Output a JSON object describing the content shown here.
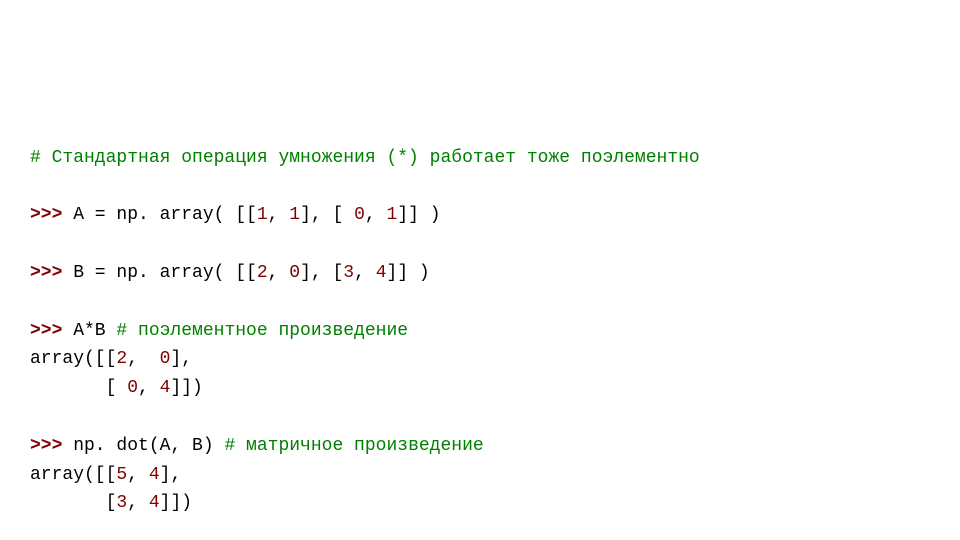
{
  "code": {
    "c1": "# Стандартная операция умножения (*) работает тоже поэлементно",
    "p1": ">>>",
    "l2a": " A = np. array( [[",
    "l2b": "1",
    "l2c": ", ",
    "l2d": "1",
    "l2e": "], [ ",
    "l2f": "0",
    "l2g": ", ",
    "l2h": "1",
    "l2i": "]] )",
    "p2": ">>>",
    "l3a": " B = np. array( [[",
    "l3b": "2",
    "l3c": ", ",
    "l3d": "0",
    "l3e": "], [",
    "l3f": "3",
    "l3g": ", ",
    "l3h": "4",
    "l3i": "]] )",
    "p3": ">>>",
    "l4a": " A*B ",
    "c2": "# поэлементное произведение",
    "l5a": "array([[",
    "l5b": "2",
    "l5c": ",  ",
    "l5d": "0",
    "l5e": "],",
    "l6a": "       [ ",
    "l6b": "0",
    "l6c": ", ",
    "l6d": "4",
    "l6e": "]])",
    "p4": ">>>",
    "l7a": " np. dot(A, B) ",
    "c3": "# матричное произведение",
    "l8a": "array([[",
    "l8b": "5",
    "l8c": ", ",
    "l8d": "4",
    "l8e": "],",
    "l9a": "       [",
    "l9b": "3",
    "l9c": ", ",
    "l9d": "4",
    "l9e": "]])"
  }
}
